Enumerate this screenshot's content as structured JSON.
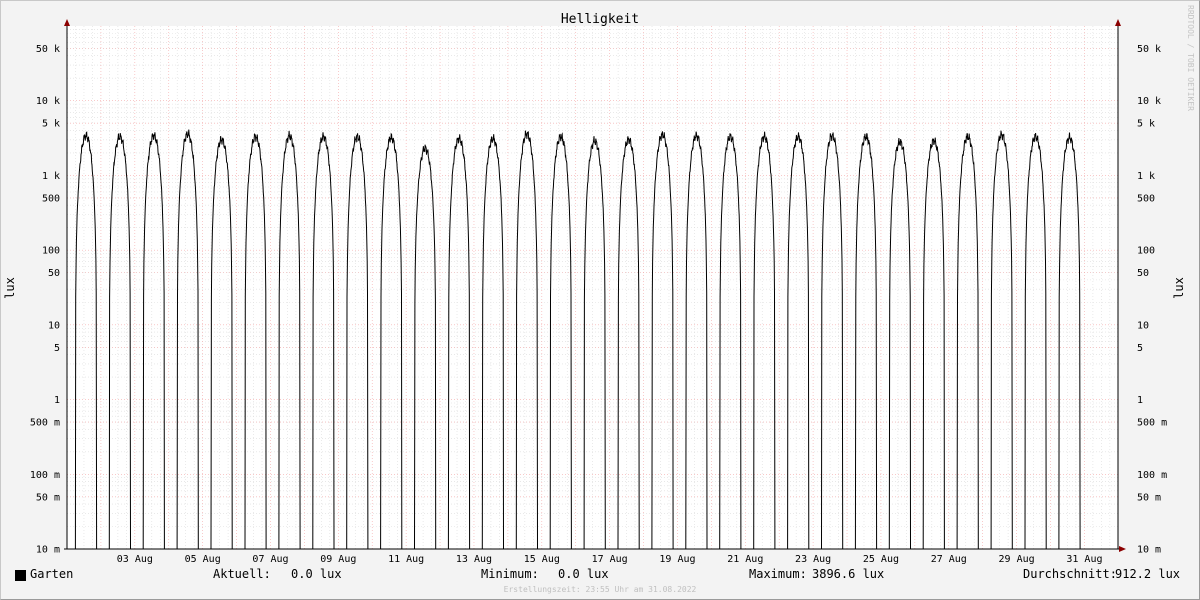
{
  "chart_data": {
    "type": "line",
    "title": "Helligkeit",
    "ylabel": "lux",
    "y_scale": "log",
    "ylim": [
      0.01,
      100000
    ],
    "grid": true,
    "y_ticks": [
      {
        "value": 50000,
        "label": "50 k"
      },
      {
        "value": 10000,
        "label": "10 k"
      },
      {
        "value": 5000,
        "label": "5 k"
      },
      {
        "value": 1000,
        "label": "1 k"
      },
      {
        "value": 500,
        "label": "500"
      },
      {
        "value": 100,
        "label": "100"
      },
      {
        "value": 50,
        "label": "50"
      },
      {
        "value": 10,
        "label": "10"
      },
      {
        "value": 5,
        "label": "5"
      },
      {
        "value": 1,
        "label": "1"
      },
      {
        "value": 0.5,
        "label": "500 m"
      },
      {
        "value": 0.1,
        "label": "100 m"
      },
      {
        "value": 0.05,
        "label": "50 m"
      },
      {
        "value": 0.01,
        "label": "10 m"
      }
    ],
    "x_tick_labels": [
      "03 Aug",
      "05 Aug",
      "07 Aug",
      "09 Aug",
      "11 Aug",
      "13 Aug",
      "15 Aug",
      "17 Aug",
      "19 Aug",
      "21 Aug",
      "23 Aug",
      "25 Aug",
      "27 Aug",
      "29 Aug",
      "31 Aug"
    ],
    "x_range_days": [
      1.0,
      31.99
    ],
    "series": [
      {
        "name": "Garten",
        "color": "#000000",
        "daily_peak_lux": [
          3400,
          3300,
          3400,
          3600,
          3000,
          3300,
          3400,
          3300,
          3300,
          3200,
          2300,
          3100,
          3100,
          3600,
          3300,
          2900,
          3000,
          3500,
          3400,
          3300,
          3300,
          3300,
          3400,
          3300,
          2800,
          2900,
          3300,
          3500,
          3300,
          3200
        ]
      }
    ]
  },
  "legend": {
    "series_name": "Garten",
    "current_label": "Aktuell:",
    "current_value": "0.0 lux",
    "min_label": "Minimum:",
    "min_value": "0.0 lux",
    "max_label": "Maximum:",
    "max_value": "3896.6 lux",
    "avg_label": "Durchschnitt:",
    "avg_value": "912.2 lux"
  },
  "footer": "Erstellungszeit: 23:55 Uhr am 31.08.2022",
  "watermark": "RRDTOOL / TOBI OETIKER"
}
